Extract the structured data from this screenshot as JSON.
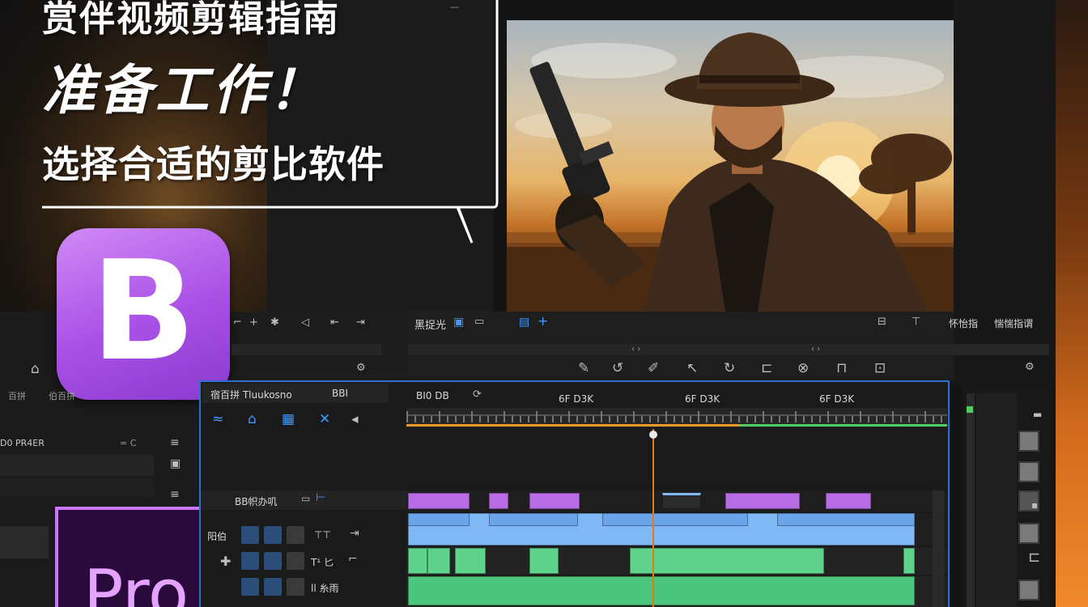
{
  "headline": {
    "line1": "赏伴视频剪辑指南",
    "line2": "准备工作！",
    "line3": "选择合适的剪比软件"
  },
  "logos": {
    "b_letter": "B",
    "pro_label": "Pro"
  },
  "preview_toolbar": {
    "left_label": "黑捉光",
    "right_label1": "怀怡指",
    "right_label2": "惴惴指谓",
    "scrub_text_a": "‹ ›",
    "scrub_text_b": "‹ ›"
  },
  "left_panel": {
    "tab1": "百拼",
    "tab2": "伯百拼",
    "section_label": "D0 PR4ER",
    "minus": "= C"
  },
  "timeline": {
    "panel_title": "宿百拼 Tluukosno",
    "panel_field": "BBI",
    "ruler_left": "BI0 DB",
    "ruler_t1": "6F D3K",
    "ruler_t2": "6F D3K",
    "ruler_t3": "6F D3K",
    "track_label": "BB帜办叽",
    "row1_label": "阳伯",
    "row2_label": "T¹ 匕",
    "row3_label": "ll 糸雨"
  },
  "colors": {
    "accent_blue": "#2f6fd0",
    "clip_purple": "#b86ce4",
    "clip_blue": "#7fb8f5",
    "clip_green": "#5fd38c",
    "playhead": "#e07a1a",
    "logo_b": "#a84fe6",
    "logo_pr_border": "#c975ff"
  }
}
